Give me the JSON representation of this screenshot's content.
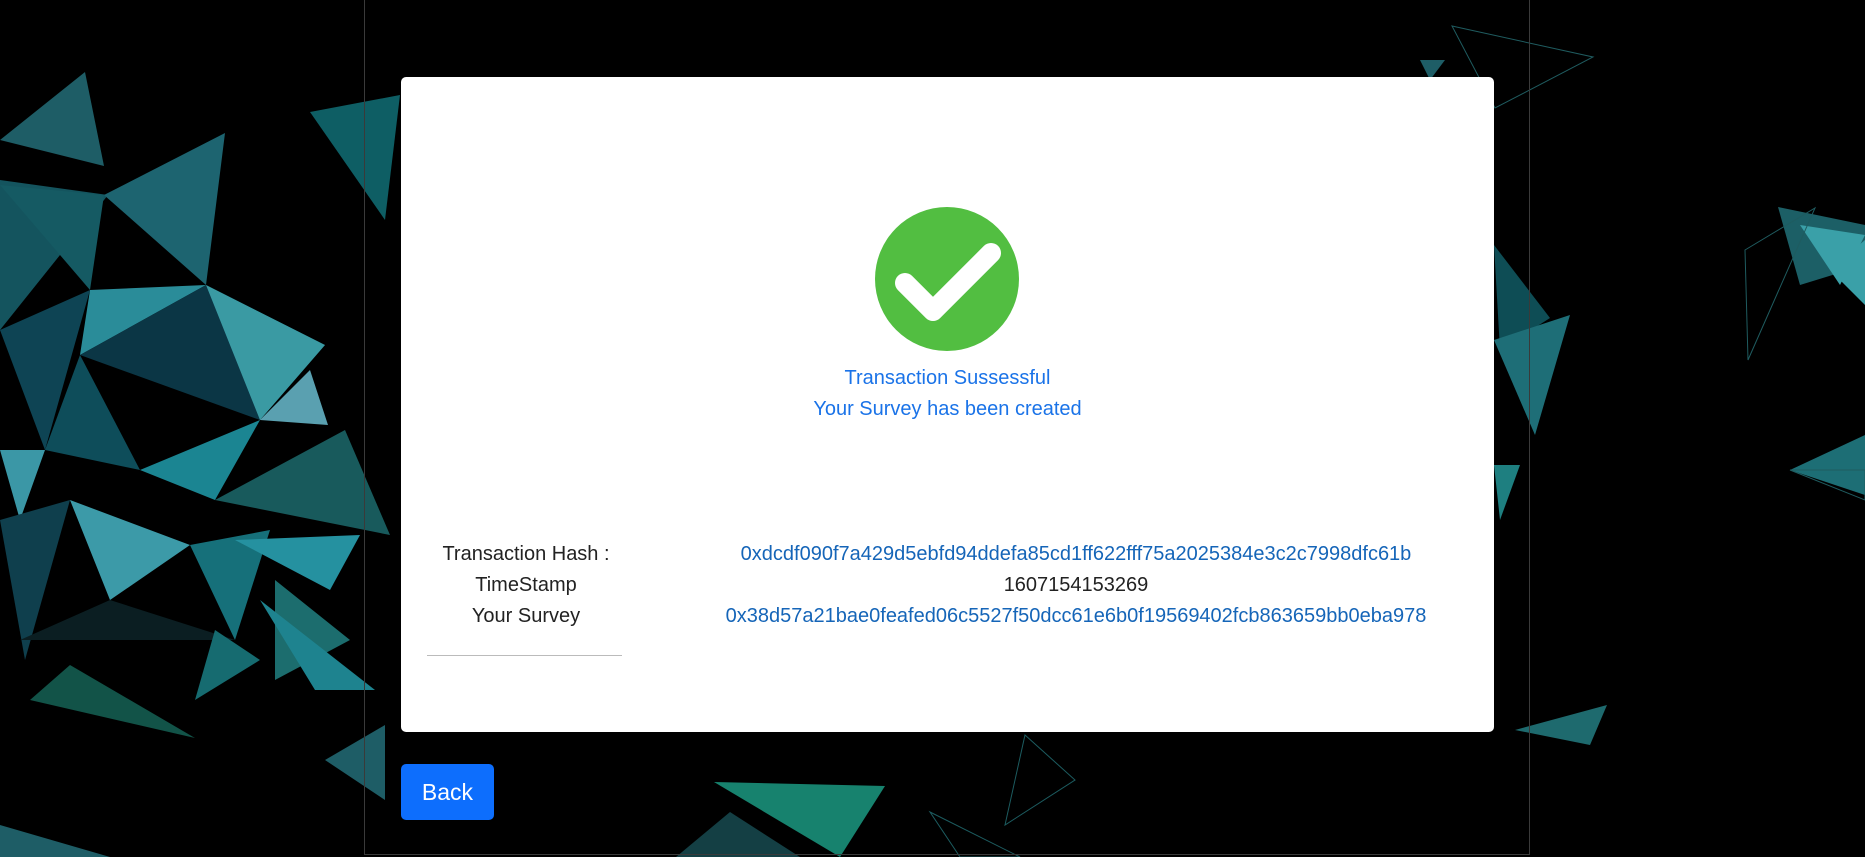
{
  "status": {
    "line1": "Transaction Sussessful",
    "line2": "Your Survey has been created",
    "icon": "check-circle-icon",
    "color": "#52be41"
  },
  "details": {
    "hash_label": "Transaction Hash :",
    "hash_value": "0xdcdf090f7a429d5ebfd94ddefa85cd1ff622fff75a2025384e3c2c7998dfc61b",
    "timestamp_label": "TimeStamp",
    "timestamp_value": "1607154153269",
    "survey_label": "Your Survey",
    "survey_value": "0x38d57a21bae0feafed06c5527f50dcc61e6b0f19569402fcb863659bb0eba978"
  },
  "actions": {
    "back_label": "Back"
  },
  "colors": {
    "accent": "#0d6efd",
    "link": "#1565b8",
    "background": "#000000",
    "decor_teal": "#1f7f8c"
  }
}
